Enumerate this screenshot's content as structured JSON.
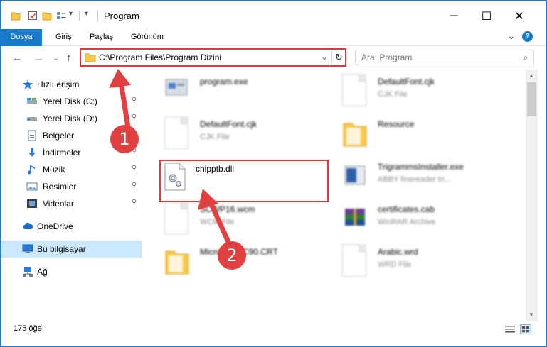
{
  "window": {
    "title": "Program",
    "minimize_glyph": "─",
    "maximize_glyph": "☐",
    "close_glyph": "✕"
  },
  "ribbon": {
    "tabs": [
      "Dosya",
      "Giriş",
      "Paylaş",
      "Görünüm"
    ],
    "expand_glyph": "⌄",
    "help_glyph": "?"
  },
  "nav": {
    "back_glyph": "←",
    "forward_glyph": "→",
    "recent_glyph": "⌄",
    "up_glyph": "↑",
    "address": "C:\\Program Files\\Program Dizini",
    "address_dropdown_glyph": "⌄",
    "refresh_glyph": "↻",
    "search_placeholder": "Ara: Program",
    "search_glyph": "⌕"
  },
  "sidebar": {
    "items": [
      {
        "label": "Hızlı erişim",
        "icon": "star-icon",
        "pinned": false
      },
      {
        "label": "Yerel Disk (C:)",
        "icon": "drive-icon",
        "pinned": true
      },
      {
        "label": "Yerel Disk (D:)",
        "icon": "drive-icon",
        "pinned": true
      },
      {
        "label": "Belgeler",
        "icon": "documents-icon",
        "pinned": true
      },
      {
        "label": "İndirmeler",
        "icon": "download-icon",
        "pinned": true
      },
      {
        "label": "Müzik",
        "icon": "music-icon",
        "pinned": true
      },
      {
        "label": "Resimler",
        "icon": "pictures-icon",
        "pinned": true
      },
      {
        "label": "Videolar",
        "icon": "videos-icon",
        "pinned": true
      },
      {
        "label": "OneDrive",
        "icon": "cloud-icon",
        "pinned": false
      },
      {
        "label": "Bu bilgisayar",
        "icon": "computer-icon",
        "pinned": false,
        "selected": true
      },
      {
        "label": "Ağ",
        "icon": "network-icon",
        "pinned": false
      }
    ],
    "pin_glyph": "📌"
  },
  "files": [
    {
      "name": "program.exe",
      "type": ""
    },
    {
      "name": "DefaultFont.cjk",
      "type": "CJK File"
    },
    {
      "name": "DefaultFont.cjk",
      "type": "CJK File"
    },
    {
      "name": "Resource",
      "type": ""
    },
    {
      "name": "chipptb.dll",
      "type": ""
    },
    {
      "name": "TrigrammsInstaller.exe",
      "type": "ABBY finereader tri..."
    },
    {
      "name": "SCWP16.wcm",
      "type": "WCM File"
    },
    {
      "name": "certificates.cab",
      "type": "WinRAR Archive"
    },
    {
      "name": "Microsoft.VC90.CRT",
      "type": ""
    },
    {
      "name": "Arabic.wrd",
      "type": "WRD File"
    }
  ],
  "status": {
    "item_count": "175 öğe"
  },
  "annotations": {
    "marker1": "1",
    "marker2": "2"
  },
  "colors": {
    "accent": "#1979ca",
    "highlight": "#e03a3a",
    "selected": "#cce8ff"
  }
}
